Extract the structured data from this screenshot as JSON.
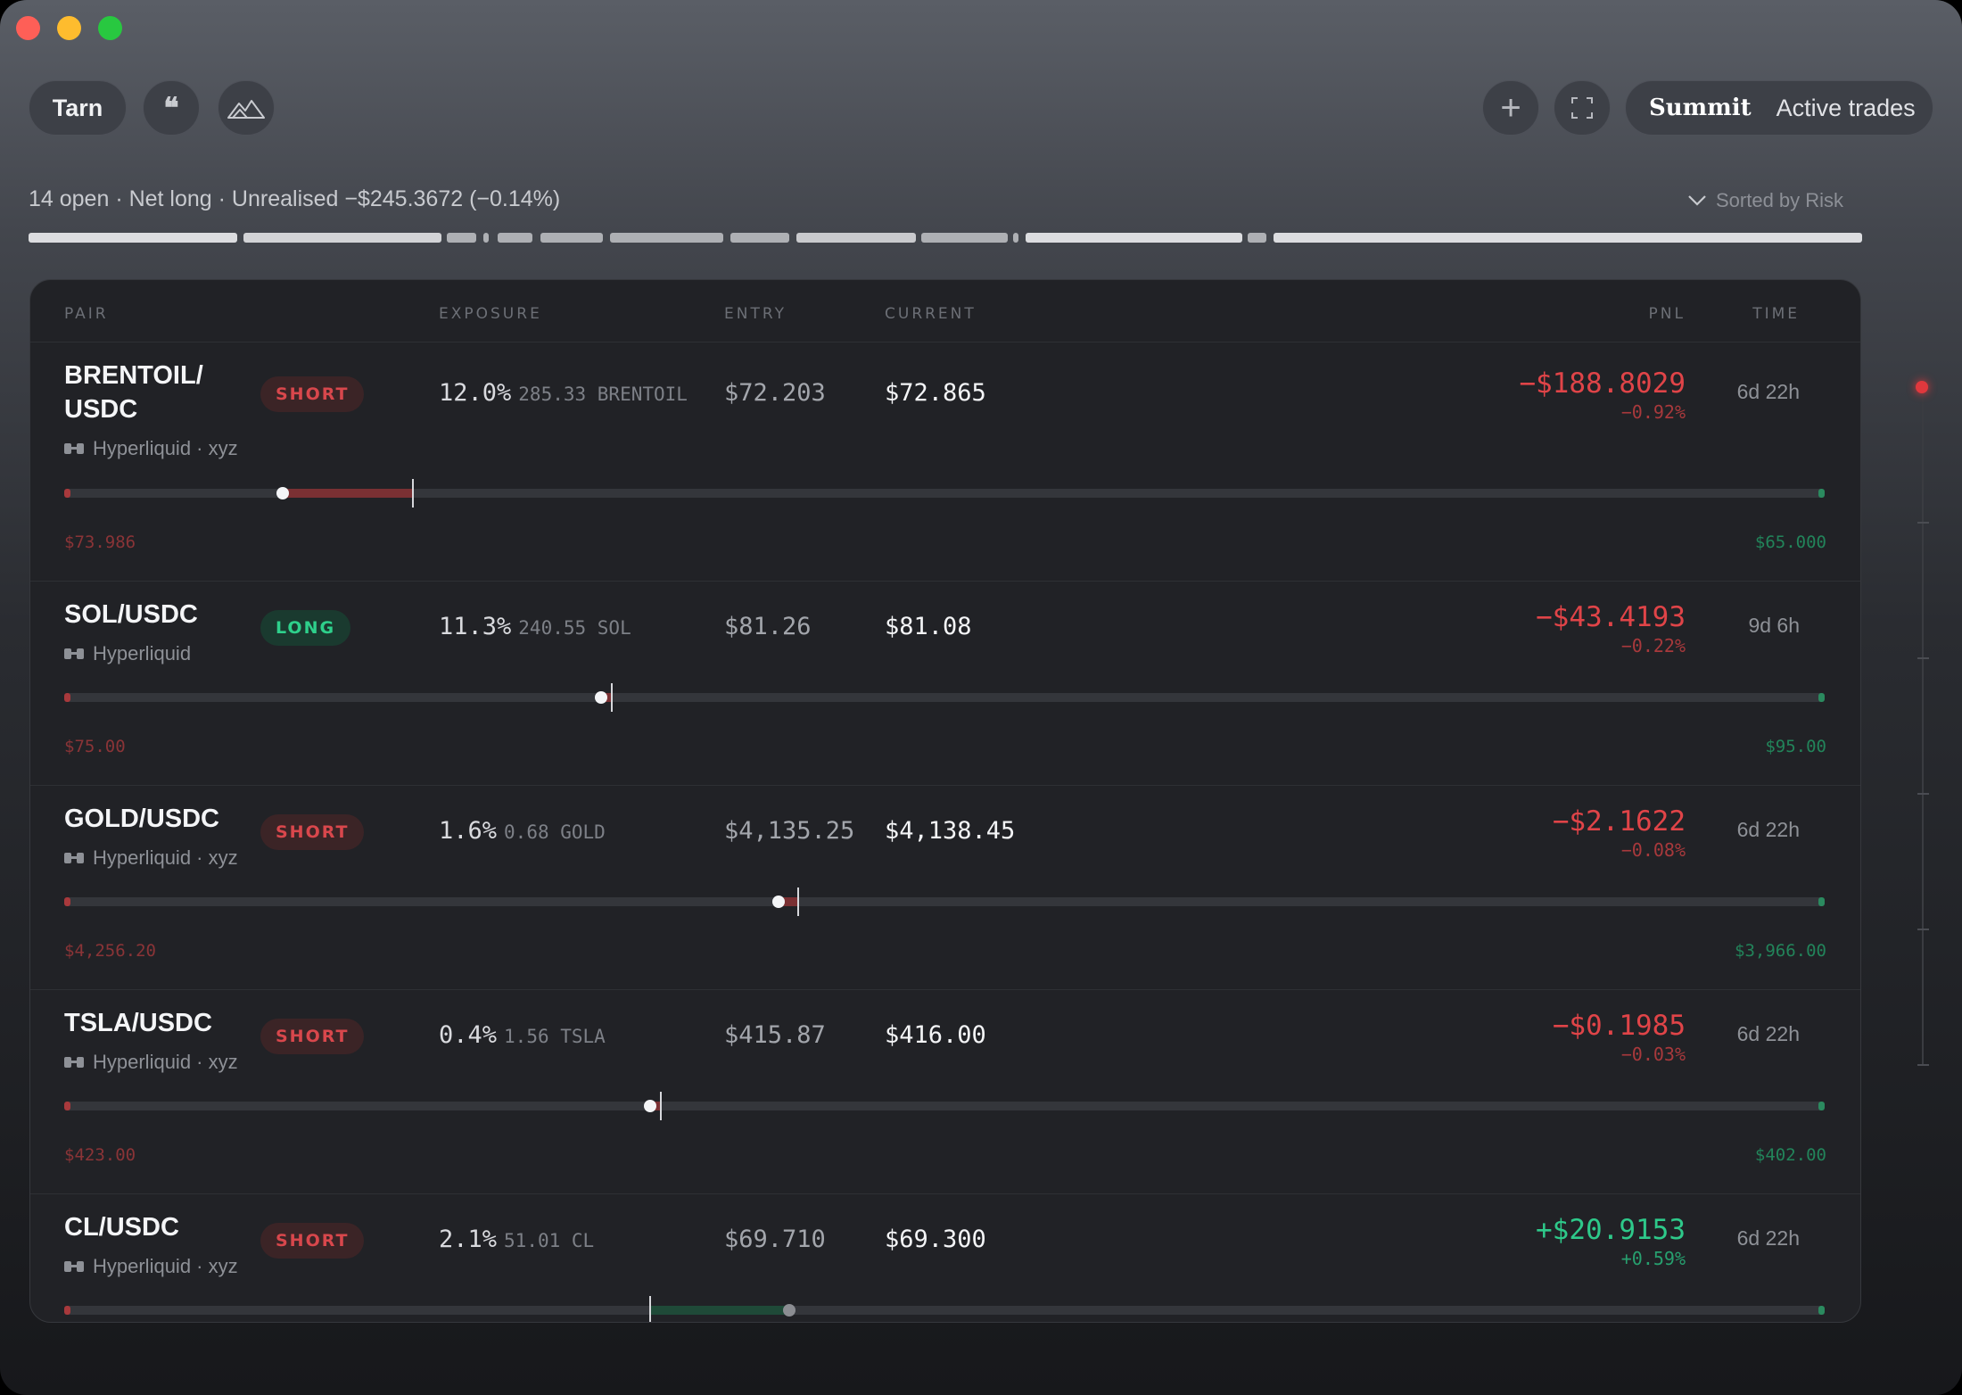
{
  "toolbar": {
    "app_label": "Tarn",
    "quote_icon": "❝",
    "mountain_icon": "mountain-icon",
    "plus_icon": "+",
    "expand_icon": "expand-icon",
    "workspace_title": "Summit",
    "workspace_subtitle": "Active trades"
  },
  "summary": {
    "text": "14 open · Net long · Unrealised −$245.3672 (−0.14%)",
    "sort_label": "Sorted by Risk"
  },
  "risk_segments": [
    {
      "start": 0.0,
      "end": 0.114,
      "color": "#dcdde0"
    },
    {
      "start": 0.117,
      "end": 0.225,
      "color": "#d2d3d6"
    },
    {
      "start": 0.228,
      "end": 0.244,
      "color": "#aeb0b4"
    },
    {
      "start": 0.248,
      "end": 0.251,
      "color": "#aeb0b4"
    },
    {
      "start": 0.256,
      "end": 0.275,
      "color": "#aeb0b4"
    },
    {
      "start": 0.279,
      "end": 0.313,
      "color": "#aeb0b4"
    },
    {
      "start": 0.317,
      "end": 0.379,
      "color": "#aeb0b4"
    },
    {
      "start": 0.383,
      "end": 0.415,
      "color": "#aeb0b4"
    },
    {
      "start": 0.419,
      "end": 0.484,
      "color": "#c9cacd"
    },
    {
      "start": 0.487,
      "end": 0.534,
      "color": "#aeb0b4"
    },
    {
      "start": 0.537,
      "end": 0.54,
      "color": "#aeb0b4"
    },
    {
      "start": 0.544,
      "end": 0.662,
      "color": "#dcdde0"
    },
    {
      "start": 0.665,
      "end": 0.675,
      "color": "#aeb0b4"
    },
    {
      "start": 0.679,
      "end": 1.0,
      "color": "#dcdde0"
    }
  ],
  "table": {
    "headers": {
      "pair": "PAIR",
      "exposure": "EXPOSURE",
      "entry": "ENTRY",
      "current": "CURRENT",
      "pnl": "PNL",
      "time": "TIME"
    },
    "rows": [
      {
        "pair": "BRENTOIL/\nUSDC",
        "venue": "Hyperliquid · xyz",
        "side": "SHORT",
        "exposure_pct": "12.0%",
        "exposure_qty": "285.33 BRENTOIL",
        "entry": "$72.203",
        "current": "$72.865",
        "pnl": "−$188.8029",
        "pnl_pct": "−0.92%",
        "time": "6d 22h",
        "stop_loss": "$73.986",
        "take_profit": "$65.000",
        "entry_pos": 0.198,
        "current_pos": 0.124
      },
      {
        "pair": "SOL/USDC",
        "venue": "Hyperliquid",
        "side": "LONG",
        "exposure_pct": "11.3%",
        "exposure_qty": "240.55 SOL",
        "entry": "$81.26",
        "current": "$81.08",
        "pnl": "−$43.4193",
        "pnl_pct": "−0.22%",
        "time": "9d 6h",
        "stop_loss": "$75.00",
        "take_profit": "$95.00",
        "entry_pos": 0.311,
        "current_pos": 0.305
      },
      {
        "pair": "GOLD/USDC",
        "venue": "Hyperliquid · xyz",
        "side": "SHORT",
        "exposure_pct": "1.6%",
        "exposure_qty": "0.68 GOLD",
        "entry": "$4,135.25",
        "current": "$4,138.45",
        "pnl": "−$2.1622",
        "pnl_pct": "−0.08%",
        "time": "6d 22h",
        "stop_loss": "$4,256.20",
        "take_profit": "$3,966.00",
        "entry_pos": 0.417,
        "current_pos": 0.406
      },
      {
        "pair": "TSLA/USDC",
        "venue": "Hyperliquid · xyz",
        "side": "SHORT",
        "exposure_pct": "0.4%",
        "exposure_qty": "1.56 TSLA",
        "entry": "$415.87",
        "current": "$416.00",
        "pnl": "−$0.1985",
        "pnl_pct": "−0.03%",
        "time": "6d 22h",
        "stop_loss": "$423.00",
        "take_profit": "$402.00",
        "entry_pos": 0.339,
        "current_pos": 0.333
      },
      {
        "pair": "CL/USDC",
        "venue": "Hyperliquid · xyz",
        "side": "SHORT",
        "exposure_pct": "2.1%",
        "exposure_qty": "51.01 CL",
        "entry": "$69.710",
        "current": "$69.300",
        "pnl": "+$20.9153",
        "pnl_pct": "+0.59%",
        "time": "6d 22h",
        "stop_loss": "",
        "take_profit": "",
        "entry_pos": 0.333,
        "current_pos": 0.412
      }
    ]
  },
  "colors": {
    "negative": "#e04448",
    "positive": "#2ec98a",
    "short_badge": "#d8474c",
    "long_badge": "#2ed08b"
  }
}
